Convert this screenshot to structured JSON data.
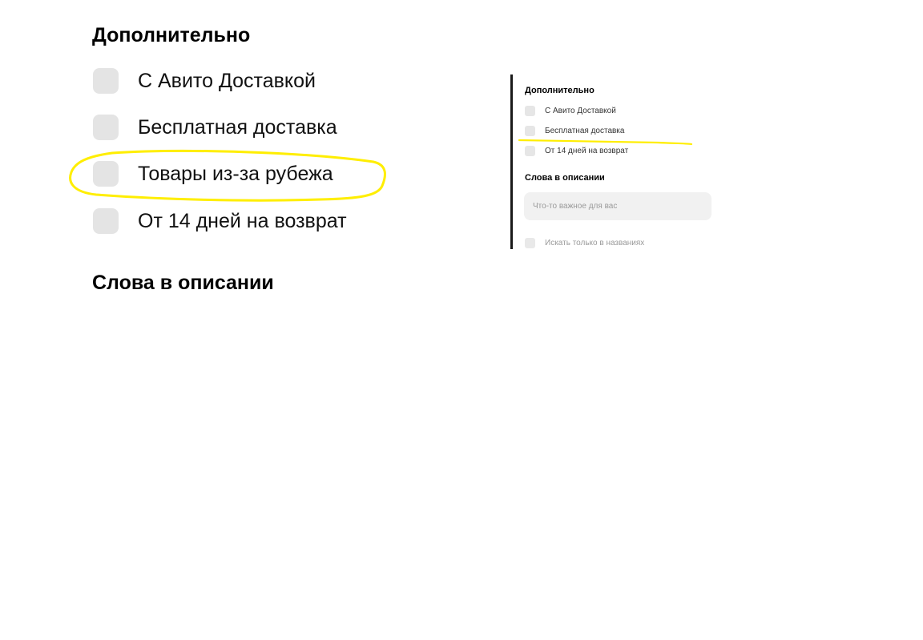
{
  "main": {
    "section_title": "Дополнительно",
    "options": [
      {
        "label": "С Авито Доставкой"
      },
      {
        "label": "Бесплатная доставка"
      },
      {
        "label": "Товары из-за рубежа"
      },
      {
        "label": "От 14 дней на возврат"
      }
    ],
    "description_title": "Слова в описании"
  },
  "reference": {
    "section_title": "Дополнительно",
    "options": [
      {
        "label": "С Авито Доставкой"
      },
      {
        "label": "Бесплатная доставка"
      },
      {
        "label": "От 14 дней на возврат"
      }
    ],
    "description_title": "Слова в описании",
    "search": {
      "value": "",
      "placeholder": "Что-то важное для вас"
    },
    "titles_only_label": "Искать только в названиях"
  },
  "colors": {
    "annotation": "#ffee00",
    "checkbox": "#e4e4e4",
    "divider": "#1a1a1a"
  }
}
